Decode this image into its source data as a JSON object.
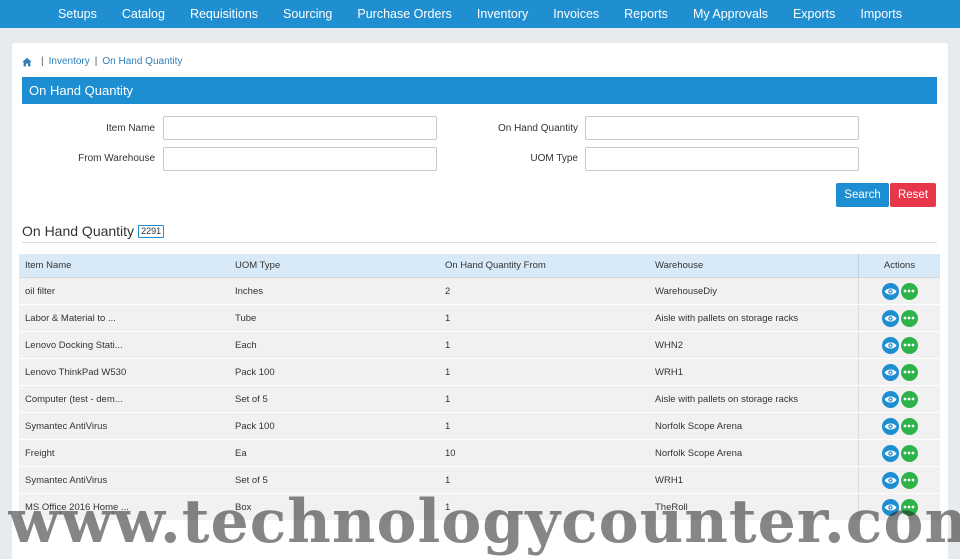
{
  "nav": {
    "items": [
      "Setups",
      "Catalog",
      "Requisitions",
      "Sourcing",
      "Purchase Orders",
      "Inventory",
      "Invoices",
      "Reports",
      "My Approvals",
      "Exports",
      "Imports"
    ]
  },
  "breadcrumb": {
    "sep": "|",
    "level1": "Inventory",
    "level2": "On Hand Quantity"
  },
  "section_title": "On Hand Quantity",
  "form": {
    "item_name_label": "Item Name",
    "item_name_value": "",
    "on_hand_label": "On Hand Quantity",
    "on_hand_value": "",
    "warehouse_label": "From Warehouse",
    "warehouse_value": "",
    "uom_label": "UOM Type",
    "uom_value": "",
    "search_label": "Search",
    "reset_label": "Reset"
  },
  "list": {
    "title": "On Hand Quantity",
    "count": "2291"
  },
  "table": {
    "columns": [
      "Item Name",
      "UOM Type",
      "On Hand Quantity From",
      "Warehouse",
      "Actions"
    ],
    "rows": [
      [
        "oil filter",
        "Inches",
        "2",
        "WarehouseDiy"
      ],
      [
        "Labor & Material to ...",
        "Tube",
        "1",
        "Aisle with pallets on storage racks"
      ],
      [
        "Lenovo Docking Stati...",
        "Each",
        "1",
        "WHN2"
      ],
      [
        "Lenovo ThinkPad W530",
        "Pack 100",
        "1",
        "WRH1"
      ],
      [
        "Computer (test - dem...",
        "Set of 5",
        "1",
        "Aisle with pallets on storage racks"
      ],
      [
        "Symantec AntiVirus",
        "Pack 100",
        "1",
        "Norfolk Scope Arena"
      ],
      [
        "Freight",
        "Ea",
        "10",
        "Norfolk Scope Arena"
      ],
      [
        "Symantec AntiVirus",
        "Set of 5",
        "1",
        "WRH1"
      ],
      [
        "MS Office 2016 Home ...",
        "Box",
        "1",
        "TheRoll"
      ]
    ]
  },
  "watermark": "www.technologycounter.com",
  "colors": {
    "brand": "#1f8fd2",
    "reset": "#e8374a",
    "more": "#2db34a",
    "header_row": "#d8eaf8"
  },
  "icons": {
    "home": "home-icon",
    "view": "eye-icon",
    "more": "more-dots-icon"
  }
}
